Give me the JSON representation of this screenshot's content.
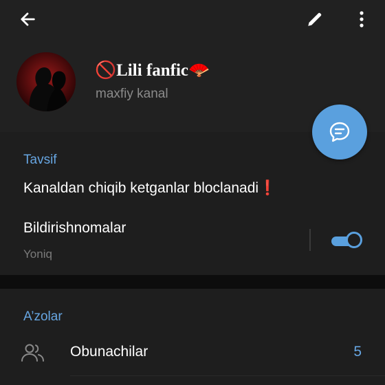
{
  "toolbar": {
    "back_icon": "arrow-left-icon",
    "edit_icon": "pencil-icon",
    "more_icon": "vertical-dots-icon"
  },
  "channel": {
    "title": "🚫Lili fanfic🪭",
    "subtitle": "maxfiy kanal"
  },
  "fab": {
    "icon": "chat-bubble-icon"
  },
  "info": {
    "section_label": "Tavsif",
    "description": "Kanaldan chiqib ketganlar bloclanadi❗",
    "notifications_title": "Bildirishnomalar",
    "notifications_status": "Yoniq",
    "notifications_enabled": true
  },
  "members": {
    "section_label": "A’zolar",
    "subscribers_label": "Obunachilar",
    "subscribers_count": "5"
  },
  "colors": {
    "accent": "#5aa0de",
    "header_bg": "#212121",
    "section_bg": "#1e1e1e",
    "label_blue": "#67a6e2"
  }
}
